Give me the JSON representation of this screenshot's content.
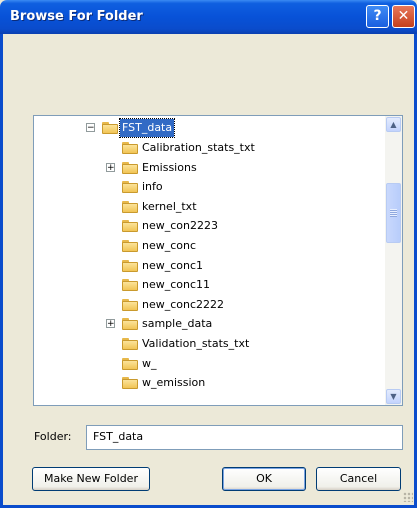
{
  "window": {
    "title": "Browse For Folder",
    "help_glyph": "?",
    "close_glyph": "✕"
  },
  "tree": {
    "root": {
      "label": "FST_data",
      "expander": "⊟",
      "selected": true
    },
    "items": [
      {
        "label": "Calibration_stats_txt",
        "expander": ""
      },
      {
        "label": "Emissions",
        "expander": "+"
      },
      {
        "label": "info",
        "expander": ""
      },
      {
        "label": "kernel_txt",
        "expander": ""
      },
      {
        "label": "new_con2223",
        "expander": ""
      },
      {
        "label": "new_conc",
        "expander": ""
      },
      {
        "label": "new_conc1",
        "expander": ""
      },
      {
        "label": "new_conc11",
        "expander": ""
      },
      {
        "label": "new_conc2222",
        "expander": ""
      },
      {
        "label": "sample_data",
        "expander": "+"
      },
      {
        "label": "Validation_stats_txt",
        "expander": ""
      },
      {
        "label": "w_",
        "expander": ""
      },
      {
        "label": "w_emission",
        "expander": ""
      }
    ]
  },
  "folder_field": {
    "label": "Folder:",
    "value": "FST_data"
  },
  "buttons": {
    "make_new": "Make New Folder",
    "ok": "OK",
    "cancel": "Cancel"
  },
  "colors": {
    "titlebar": "#0a4ccc",
    "selection": "#316ac5",
    "dialog_bg": "#ece9d8"
  }
}
